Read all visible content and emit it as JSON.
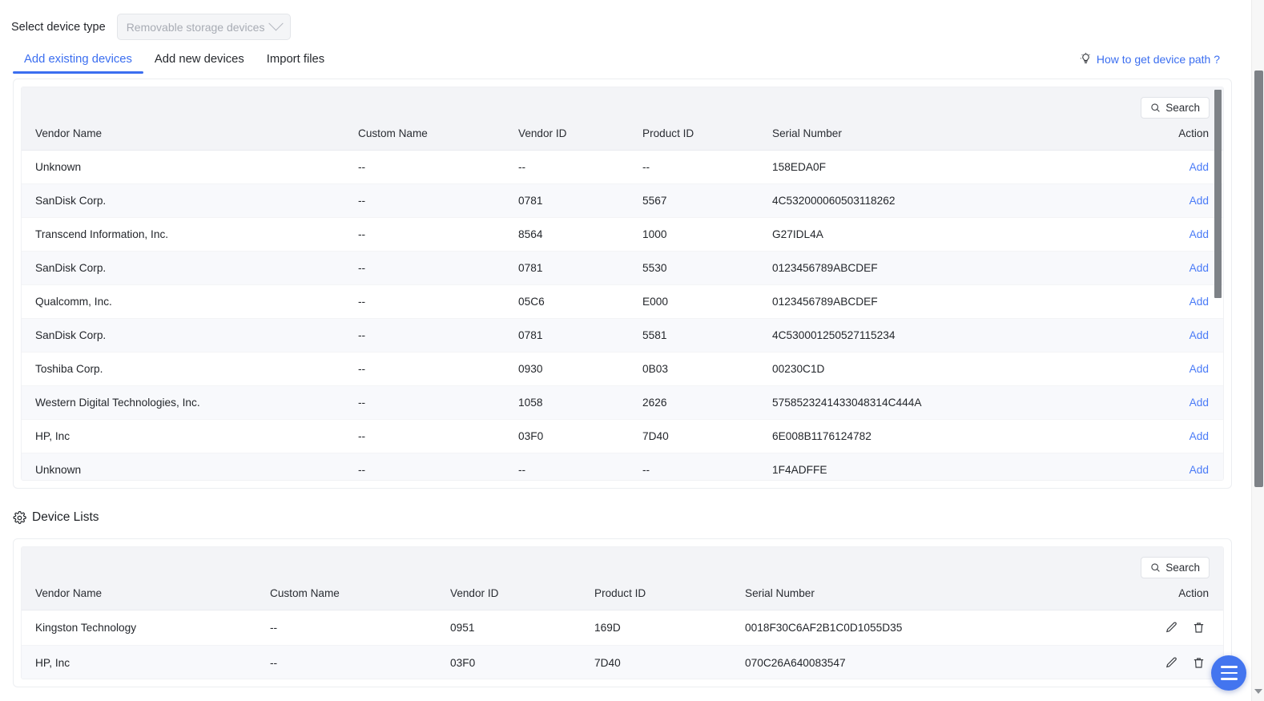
{
  "device_type": {
    "label": "Select device type",
    "selected": "Removable storage devices",
    "chevron_icon": "chevron-down-icon"
  },
  "tabs": [
    {
      "label": "Add existing devices",
      "active": true
    },
    {
      "label": "Add new devices",
      "active": false
    },
    {
      "label": "Import files",
      "active": false
    }
  ],
  "help_link": {
    "text": "How to get device path ?",
    "icon": "lightbulb-icon",
    "color": "#3b6ef0"
  },
  "existing_devices_table": {
    "search_label": "Search",
    "search_icon": "search-icon",
    "columns": [
      "Vendor Name",
      "Custom Name",
      "Vendor ID",
      "Product ID",
      "Serial Number",
      "Action"
    ],
    "rows": [
      {
        "vendor": "Unknown",
        "custom": "--",
        "vid": "--",
        "pid": "--",
        "serial": "158EDA0F",
        "action": "Add"
      },
      {
        "vendor": "SanDisk Corp.",
        "custom": "--",
        "vid": "0781",
        "pid": "5567",
        "serial": "4C532000060503118262",
        "action": "Add"
      },
      {
        "vendor": "Transcend Information, Inc.",
        "custom": "--",
        "vid": "8564",
        "pid": "1000",
        "serial": "G27IDL4A",
        "action": "Add"
      },
      {
        "vendor": "SanDisk Corp.",
        "custom": "--",
        "vid": "0781",
        "pid": "5530",
        "serial": "0123456789ABCDEF",
        "action": "Add"
      },
      {
        "vendor": "Qualcomm, Inc.",
        "custom": "--",
        "vid": "05C6",
        "pid": "E000",
        "serial": "0123456789ABCDEF",
        "action": "Add"
      },
      {
        "vendor": "SanDisk Corp.",
        "custom": "--",
        "vid": "0781",
        "pid": "5581",
        "serial": "4C530001250527115234",
        "action": "Add"
      },
      {
        "vendor": "Toshiba Corp.",
        "custom": "--",
        "vid": "0930",
        "pid": "0B03",
        "serial": "00230C1D",
        "action": "Add"
      },
      {
        "vendor": "Western Digital Technologies, Inc.",
        "custom": "--",
        "vid": "1058",
        "pid": "2626",
        "serial": "5758523241433048314C444A",
        "action": "Add"
      },
      {
        "vendor": "HP, Inc",
        "custom": "--",
        "vid": "03F0",
        "pid": "7D40",
        "serial": "6E008B1176124782",
        "action": "Add"
      },
      {
        "vendor": "Unknown",
        "custom": "--",
        "vid": "--",
        "pid": "--",
        "serial": "1F4ADFFE",
        "action": "Add"
      }
    ]
  },
  "device_lists": {
    "title": "Device Lists",
    "icon": "gear-icon",
    "search_label": "Search",
    "search_icon": "search-icon",
    "columns": [
      "Vendor Name",
      "Custom Name",
      "Vendor ID",
      "Product ID",
      "Serial Number",
      "Action"
    ],
    "rows": [
      {
        "vendor": "Kingston Technology",
        "custom": "--",
        "vid": "0951",
        "pid": "169D",
        "serial": "0018F30C6AF2B1C0D1055D35",
        "edit_icon": "pencil-icon",
        "delete_icon": "trash-icon"
      },
      {
        "vendor": "HP, Inc",
        "custom": "--",
        "vid": "03F0",
        "pid": "7D40",
        "serial": "070C26A640083547",
        "edit_icon": "pencil-icon",
        "delete_icon": "trash-icon"
      }
    ]
  },
  "fab": {
    "icon": "menu-icon",
    "color": "#4375ef"
  }
}
